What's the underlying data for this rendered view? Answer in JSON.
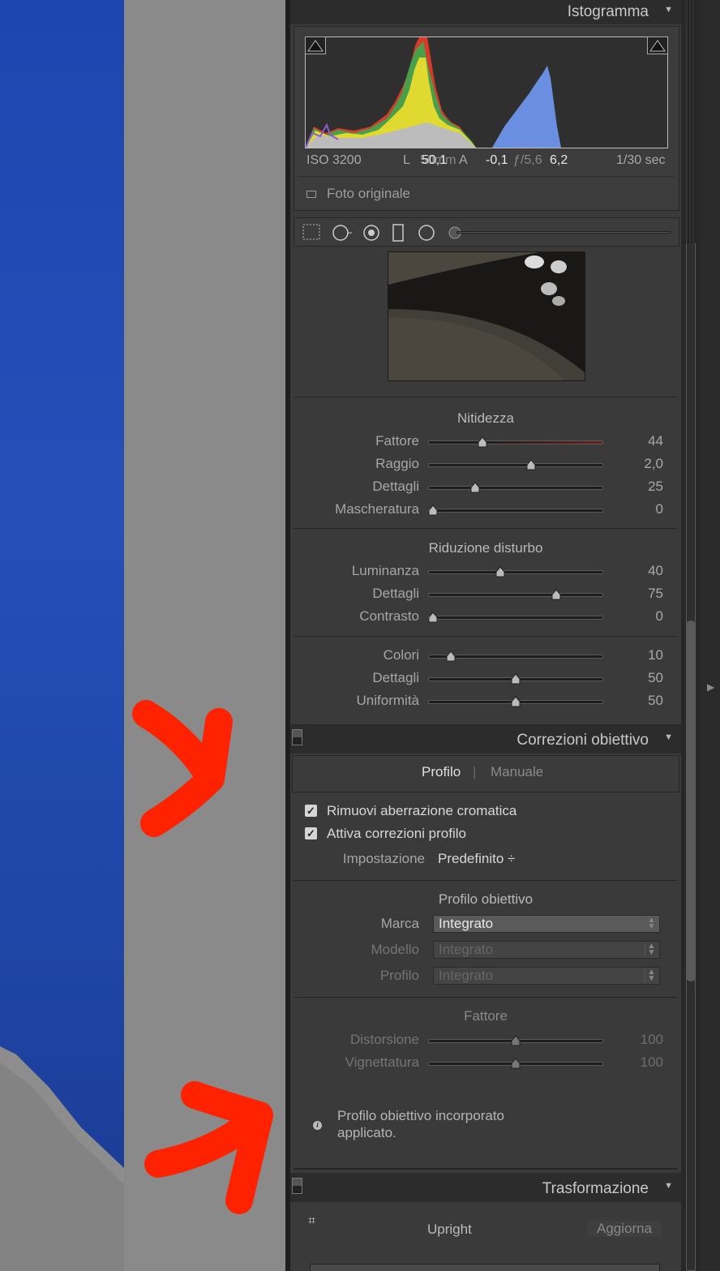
{
  "histogram": {
    "title": "Istogramma",
    "iso": "ISO 3200",
    "lens": "L",
    "focal_overlap": "50mm",
    "rgb_r": "50,1",
    "label_A": "A",
    "exp": "-0,1",
    "aperture": "ƒ/5,6",
    "b_value": "6,2",
    "shutter": "1/30 sec",
    "original_photo": "Foto originale"
  },
  "tools": {
    "icons": [
      "crop-grid-icon",
      "spot-removal-icon",
      "red-eye-icon",
      "graduated-filter-icon",
      "radial-filter-icon",
      "brush-icon"
    ]
  },
  "sharpening": {
    "title": "Nitidezza",
    "sliders": [
      {
        "label": "Fattore",
        "value": "44",
        "pos": 0.31
      },
      {
        "label": "Raggio",
        "value": "2,0",
        "pos": 0.59
      },
      {
        "label": "Dettagli",
        "value": "25",
        "pos": 0.27
      },
      {
        "label": "Mascheratura",
        "value": "0",
        "pos": 0.03
      }
    ]
  },
  "noise": {
    "title": "Riduzione disturbo",
    "sliders": [
      {
        "label": "Luminanza",
        "value": "40",
        "pos": 0.41
      },
      {
        "label": "Dettagli",
        "value": "75",
        "pos": 0.73
      },
      {
        "label": "Contrasto",
        "value": "0",
        "pos": 0.03
      }
    ],
    "color_sliders": [
      {
        "label": "Colori",
        "value": "10",
        "pos": 0.13
      },
      {
        "label": "Dettagli",
        "value": "50",
        "pos": 0.5
      },
      {
        "label": "Uniformità",
        "value": "50",
        "pos": 0.5
      }
    ]
  },
  "lens": {
    "title": "Correzioni obiettivo",
    "tab_profile": "Profilo",
    "tab_sep": "|",
    "tab_manual": "Manuale",
    "chk_ca": "Rimuovi aberrazione cromatica",
    "chk_profile": "Attiva correzioni profilo",
    "setup_label": "Impostazione",
    "setup_value": "Predefinito ÷",
    "profile_title": "Profilo obiettivo",
    "make_label": "Marca",
    "make_value": "Integrato",
    "model_label": "Modello",
    "model_value": "Integrato",
    "profile_label": "Profilo",
    "profile_value": "Integrato",
    "amount_title": "Fattore",
    "amount": [
      {
        "label": "Distorsione",
        "value": "100",
        "pos": 0.5
      },
      {
        "label": "Vignettatura",
        "value": "100",
        "pos": 0.5
      }
    ],
    "info_line1": "Profilo obiettivo incorporato",
    "info_line2": "applicato."
  },
  "transform": {
    "title": "Trasformazione",
    "upright": "Upright",
    "update": "Aggiorna"
  },
  "colors": {
    "accent_annotation": "#ff2200",
    "panel_bg": "#3a3a3a",
    "header_bg": "#2c2c2c"
  }
}
